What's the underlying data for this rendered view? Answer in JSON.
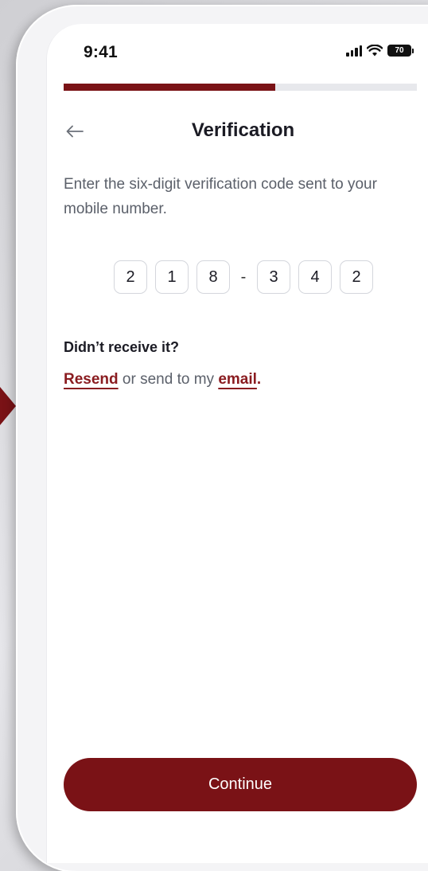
{
  "status_bar": {
    "time": "9:41",
    "battery": "70"
  },
  "progress": {
    "value": 0.6
  },
  "header": {
    "title": "Verification"
  },
  "instruction": "Enter the six-digit verification code sent to your mobile number.",
  "code": {
    "digits": [
      "2",
      "1",
      "8",
      "3",
      "4",
      "2"
    ],
    "separator": "-"
  },
  "resend": {
    "question": "Didn’t receive it?",
    "resend_label": "Resend",
    "middle_text": " or send to my ",
    "email_label": "email",
    "end_text": "."
  },
  "actions": {
    "continue_label": "Continue"
  },
  "colors": {
    "accent": "#7a1216",
    "link": "#8a1c20",
    "text_primary": "#1b1b24",
    "text_secondary": "#5b606a",
    "track": "#e7e8ec"
  }
}
